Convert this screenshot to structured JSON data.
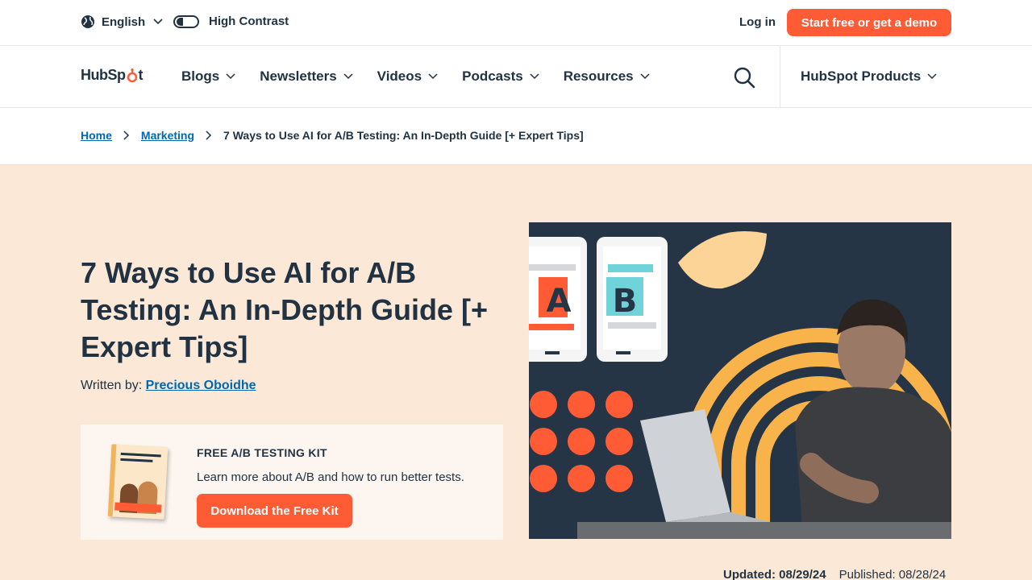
{
  "utility": {
    "language": "English",
    "contrast_label": "High Contrast",
    "login": "Log in",
    "cta": "Start free or get a demo"
  },
  "brand": {
    "logo_text_1": "HubSp",
    "logo_text_2": "t"
  },
  "nav": {
    "items": [
      "Blogs",
      "Newsletters",
      "Videos",
      "Podcasts",
      "Resources"
    ],
    "products": "HubSpot Products"
  },
  "breadcrumb": {
    "home": "Home",
    "section": "Marketing",
    "current": "7 Ways to Use AI for A/B Testing: An In-Depth Guide [+ Expert Tips]"
  },
  "article": {
    "title": "7 Ways to Use AI for A/B Testing: An In-Depth Guide [+ Expert Tips]",
    "written_by_label": "Written by:",
    "author": "Precious Oboidhe",
    "updated_label": "Updated:",
    "updated_date": "08/29/24",
    "published_label": "Published:",
    "published_date": "08/28/24"
  },
  "kit": {
    "label": "FREE A/B TESTING KIT",
    "description": "Learn more about A/B and how to run better tests.",
    "button": "Download the Free Kit"
  },
  "hero_image": {
    "tile_a": "A",
    "tile_b": "B"
  },
  "colors": {
    "accent": "#ff5c35",
    "text": "#213343",
    "link": "#0068b1",
    "hero_bg": "#fce8d6"
  },
  "icons": {
    "globe": "globe-icon",
    "chevron": "chevron-down-icon",
    "search": "search-icon",
    "toggle": "toggle-icon"
  }
}
